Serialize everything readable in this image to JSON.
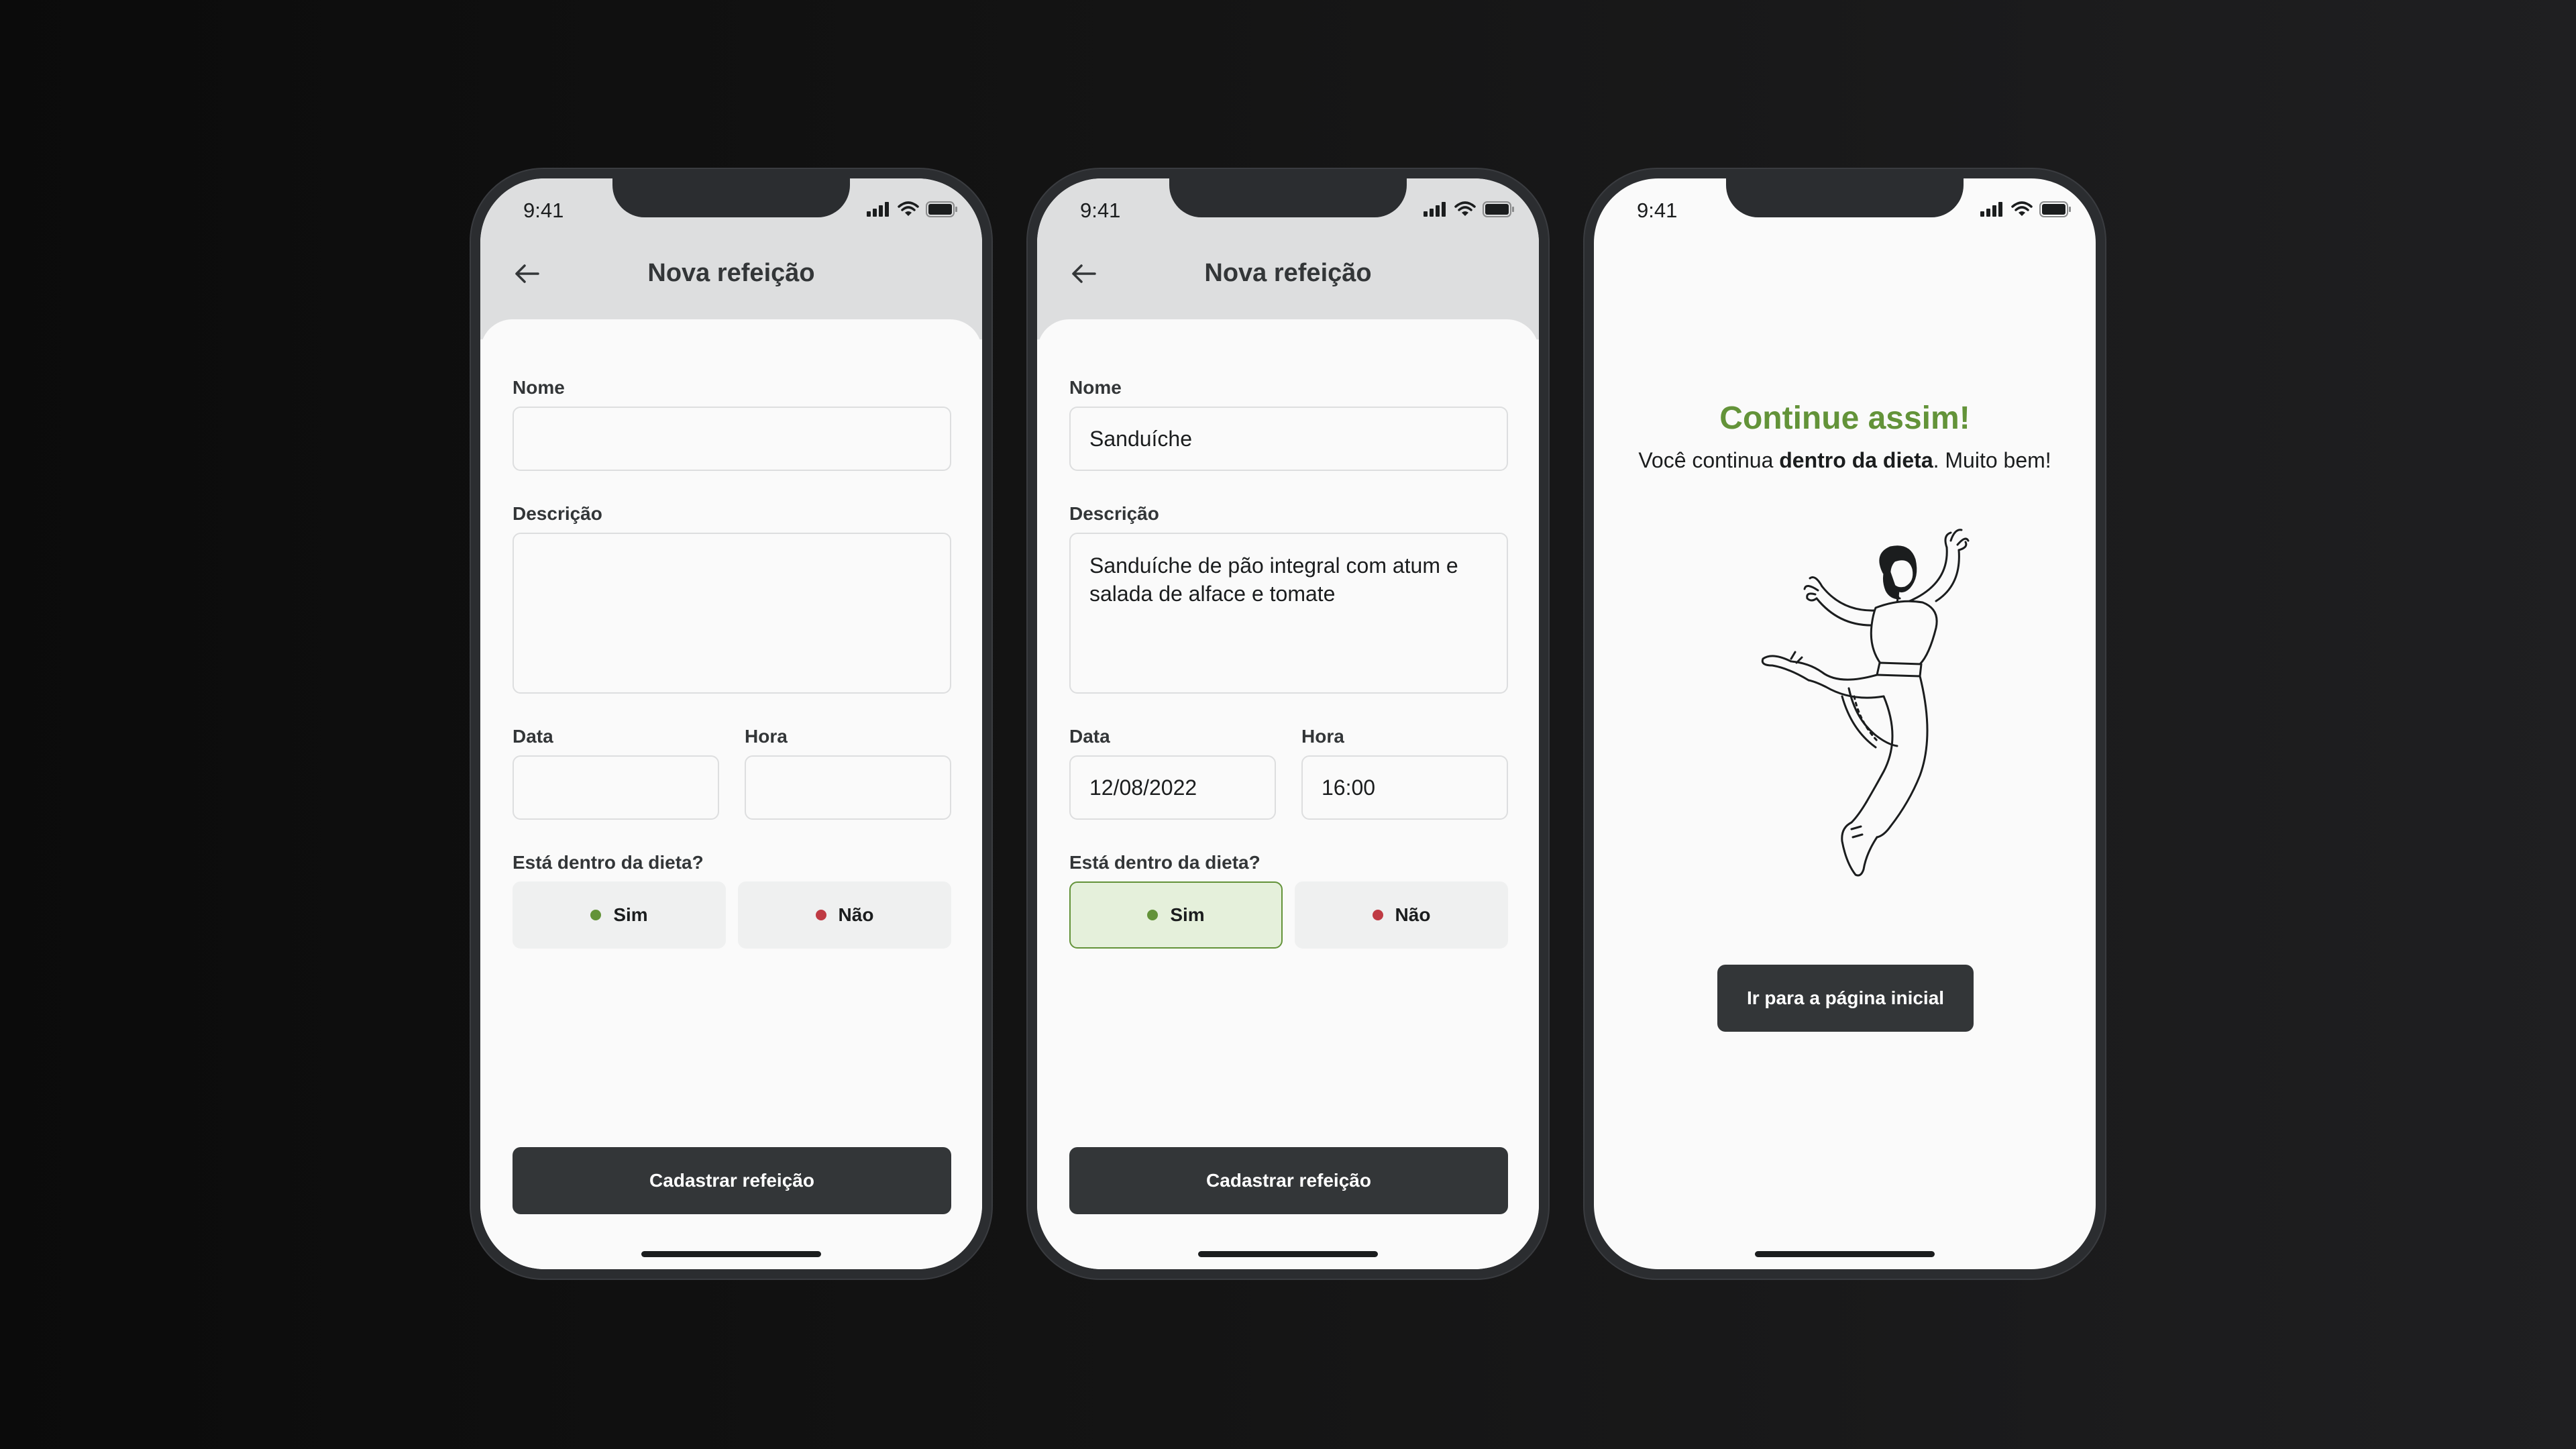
{
  "colors": {
    "green": "#639339",
    "green_light": "#e5f0db",
    "red": "#bf3b44",
    "dark": "#333638"
  },
  "phone1": {
    "status_time": "9:41",
    "header": {
      "title": "Nova refeição",
      "back_icon": "arrow-left-icon"
    },
    "form": {
      "name_label": "Nome",
      "name_value": "",
      "description_label": "Descrição",
      "description_value": "",
      "date_label": "Data",
      "date_value": "",
      "time_label": "Hora",
      "time_value": "",
      "diet_question": "Está dentro da dieta?",
      "yes_label": "Sim",
      "no_label": "Não",
      "selected": "none",
      "submit_label": "Cadastrar refeição"
    }
  },
  "phone2": {
    "status_time": "9:41",
    "header": {
      "title": "Nova refeição",
      "back_icon": "arrow-left-icon"
    },
    "form": {
      "name_label": "Nome",
      "name_value": "Sanduíche",
      "description_label": "Descrição",
      "description_value": "Sanduíche de pão integral com atum e salada de alface e tomate",
      "date_label": "Data",
      "date_value": "12/08/2022",
      "time_label": "Hora",
      "time_value": "16:00",
      "diet_question": "Está dentro da dieta?",
      "yes_label": "Sim",
      "no_label": "Não",
      "selected": "yes",
      "submit_label": "Cadastrar refeição"
    }
  },
  "phone3": {
    "status_time": "9:41",
    "feedback": {
      "title": "Continue assim!",
      "text_prefix": "Você continua ",
      "text_bold": "dentro da dieta",
      "text_suffix": ". Muito bem!",
      "illustration": "jumping-woman-illustration",
      "button_label": "Ir para a página inicial"
    }
  }
}
